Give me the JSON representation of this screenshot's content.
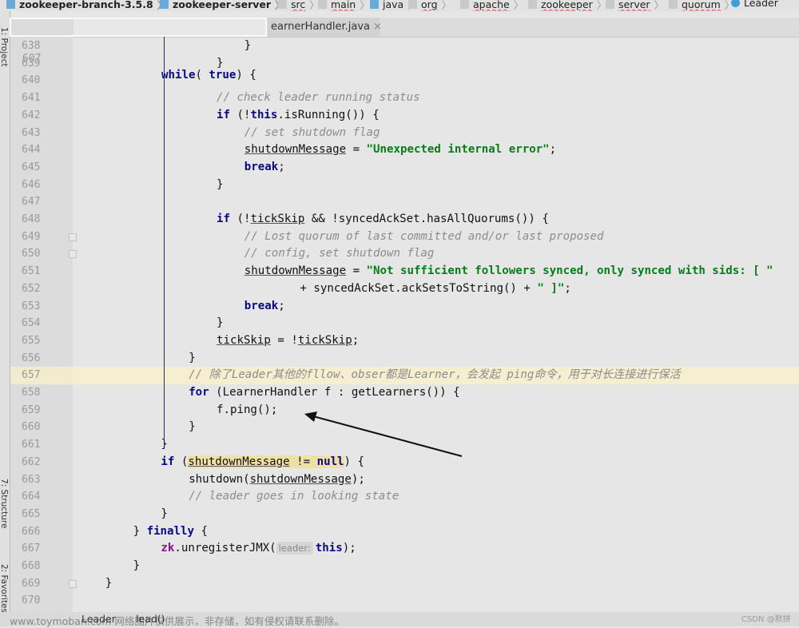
{
  "breadcrumbs": [
    {
      "label": "zookeeper-branch-3.5.8",
      "icon": "module-icon",
      "bold": true
    },
    {
      "label": "zookeeper-server",
      "icon": "module-icon",
      "bold": true
    },
    {
      "label": "src",
      "icon": "folder-icon"
    },
    {
      "label": "main",
      "icon": "folder-icon"
    },
    {
      "label": "java",
      "icon": "source-folder-icon"
    },
    {
      "label": "org",
      "icon": "package-icon"
    },
    {
      "label": "apache",
      "icon": "package-icon"
    },
    {
      "label": "zookeeper",
      "icon": "package-icon"
    },
    {
      "label": "server",
      "icon": "package-icon"
    },
    {
      "label": "quorum",
      "icon": "package-icon"
    },
    {
      "label": "Leader",
      "icon": "class-icon"
    }
  ],
  "tool_windows": [
    "1: Project",
    "7: Structure",
    "2: Favorites"
  ],
  "tab": {
    "label": "earnerHandler.java",
    "close": "×"
  },
  "sticky_line": {
    "number": "607",
    "tokens": [
      [
        "kw",
        "while"
      ],
      [
        "",
        "( "
      ],
      [
        "kw",
        "true"
      ],
      [
        "",
        ") {"
      ]
    ]
  },
  "lines": [
    {
      "n": "638",
      "indent": 24,
      "tokens": [
        [
          "",
          "}"
        ]
      ]
    },
    {
      "n": "639",
      "indent": 20,
      "tokens": [
        [
          "",
          "}"
        ]
      ]
    },
    {
      "n": "640",
      "indent": 0,
      "tokens": []
    },
    {
      "n": "641",
      "indent": 20,
      "tokens": [
        [
          "cmt",
          "// check leader running status"
        ]
      ]
    },
    {
      "n": "642",
      "indent": 20,
      "tokens": [
        [
          "kw",
          "if"
        ],
        [
          "",
          " (!"
        ],
        [
          "kw",
          "this"
        ],
        [
          "",
          ".isRunning()) {"
        ]
      ]
    },
    {
      "n": "643",
      "indent": 24,
      "tokens": [
        [
          "cmt",
          "// set shutdown flag"
        ]
      ]
    },
    {
      "n": "644",
      "indent": 24,
      "tokens": [
        [
          "ul",
          "shutdownMessage"
        ],
        [
          "",
          " = "
        ],
        [
          "str",
          "\"Unexpected internal error\""
        ],
        [
          "",
          ";"
        ]
      ]
    },
    {
      "n": "645",
      "indent": 24,
      "tokens": [
        [
          "kw",
          "break"
        ],
        [
          "",
          ";"
        ]
      ]
    },
    {
      "n": "646",
      "indent": 20,
      "tokens": [
        [
          "",
          "}"
        ]
      ]
    },
    {
      "n": "647",
      "indent": 0,
      "tokens": []
    },
    {
      "n": "648",
      "indent": 20,
      "tokens": [
        [
          "kw",
          "if"
        ],
        [
          "",
          " (!"
        ],
        [
          "ul",
          "tickSkip"
        ],
        [
          "",
          " && !syncedAckSet.hasAllQuorums()) {"
        ]
      ]
    },
    {
      "n": "649",
      "indent": 24,
      "tokens": [
        [
          "cmt",
          "// Lost quorum of last committed and/or last proposed"
        ]
      ]
    },
    {
      "n": "650",
      "indent": 24,
      "tokens": [
        [
          "cmt",
          "// config, set shutdown flag"
        ]
      ]
    },
    {
      "n": "651",
      "indent": 24,
      "tokens": [
        [
          "ul",
          "shutdownMessage"
        ],
        [
          "",
          " = "
        ],
        [
          "str",
          "\"Not sufficient followers synced, only synced with sids: [ \""
        ]
      ]
    },
    {
      "n": "652",
      "indent": 32,
      "tokens": [
        [
          "",
          "+ syncedAckSet.ackSetsToString() + "
        ],
        [
          "str",
          "\" ]\""
        ],
        [
          "",
          ";"
        ]
      ]
    },
    {
      "n": "653",
      "indent": 24,
      "tokens": [
        [
          "kw",
          "break"
        ],
        [
          "",
          ";"
        ]
      ]
    },
    {
      "n": "654",
      "indent": 20,
      "tokens": [
        [
          "",
          "}"
        ]
      ]
    },
    {
      "n": "655",
      "indent": 20,
      "tokens": [
        [
          "ul",
          "tickSkip"
        ],
        [
          "",
          " = !"
        ],
        [
          "ul",
          "tickSkip"
        ],
        [
          "",
          ";"
        ]
      ]
    },
    {
      "n": "656",
      "indent": 16,
      "tokens": [
        [
          "",
          "}"
        ]
      ]
    },
    {
      "n": "657",
      "indent": 16,
      "highlight": true,
      "tokens": [
        [
          "cmt",
          "// 除了Leader其他的fllow、obser都是Learner，会发起 ping命令，用于对长连接进行保活"
        ]
      ]
    },
    {
      "n": "658",
      "indent": 16,
      "tokens": [
        [
          "kw",
          "for"
        ],
        [
          "",
          " (LearnerHandler f : getLearners()) {"
        ]
      ]
    },
    {
      "n": "659",
      "indent": 20,
      "tokens": [
        [
          "",
          "f.ping();"
        ]
      ]
    },
    {
      "n": "660",
      "indent": 16,
      "tokens": [
        [
          "",
          "}"
        ]
      ]
    },
    {
      "n": "661",
      "indent": 12,
      "tokens": [
        [
          "",
          "}"
        ]
      ]
    },
    {
      "n": "662",
      "indent": 12,
      "tokens": [
        [
          "kw",
          "if"
        ],
        [
          "",
          " ("
        ],
        [
          "ul mark",
          "shutdownMessage"
        ],
        [
          "mark",
          " != "
        ],
        [
          "kw mark",
          "null"
        ],
        [
          "",
          ") {"
        ]
      ]
    },
    {
      "n": "663",
      "indent": 16,
      "tokens": [
        [
          "",
          "shutdown("
        ],
        [
          "ul",
          "shutdownMessage"
        ],
        [
          "",
          ");"
        ]
      ]
    },
    {
      "n": "664",
      "indent": 16,
      "tokens": [
        [
          "cmt",
          "// leader goes in looking state"
        ]
      ]
    },
    {
      "n": "665",
      "indent": 12,
      "tokens": [
        [
          "",
          "}"
        ]
      ]
    },
    {
      "n": "666",
      "indent": 8,
      "tokens": [
        [
          "",
          "} "
        ],
        [
          "kw",
          "finally"
        ],
        [
          "",
          " {"
        ]
      ]
    },
    {
      "n": "667",
      "indent": 12,
      "tokens": [
        [
          "fld",
          "zk"
        ],
        [
          "",
          ".unregisterJMX("
        ],
        [
          "hint",
          "leader:"
        ],
        [
          "kw",
          "this"
        ],
        [
          "",
          ");"
        ]
      ]
    },
    {
      "n": "668",
      "indent": 8,
      "tokens": [
        [
          "",
          "}"
        ]
      ]
    },
    {
      "n": "669",
      "indent": 4,
      "tokens": [
        [
          "",
          "}"
        ]
      ]
    },
    {
      "n": "670",
      "indent": 0,
      "tokens": []
    }
  ],
  "status": {
    "watermark": "www.toymoban.com 网络图片仅供展示，非存储，如有侵权请联系删除。",
    "breadcrumb_class": "Leader",
    "breadcrumb_method": "lead()",
    "credit": "CSDN @默拼"
  },
  "colors": {
    "keyword": "#0a0a80",
    "string": "#067d17",
    "comment": "#8c8c8c",
    "field": "#871094",
    "highlight_line": "#f5eccb"
  }
}
